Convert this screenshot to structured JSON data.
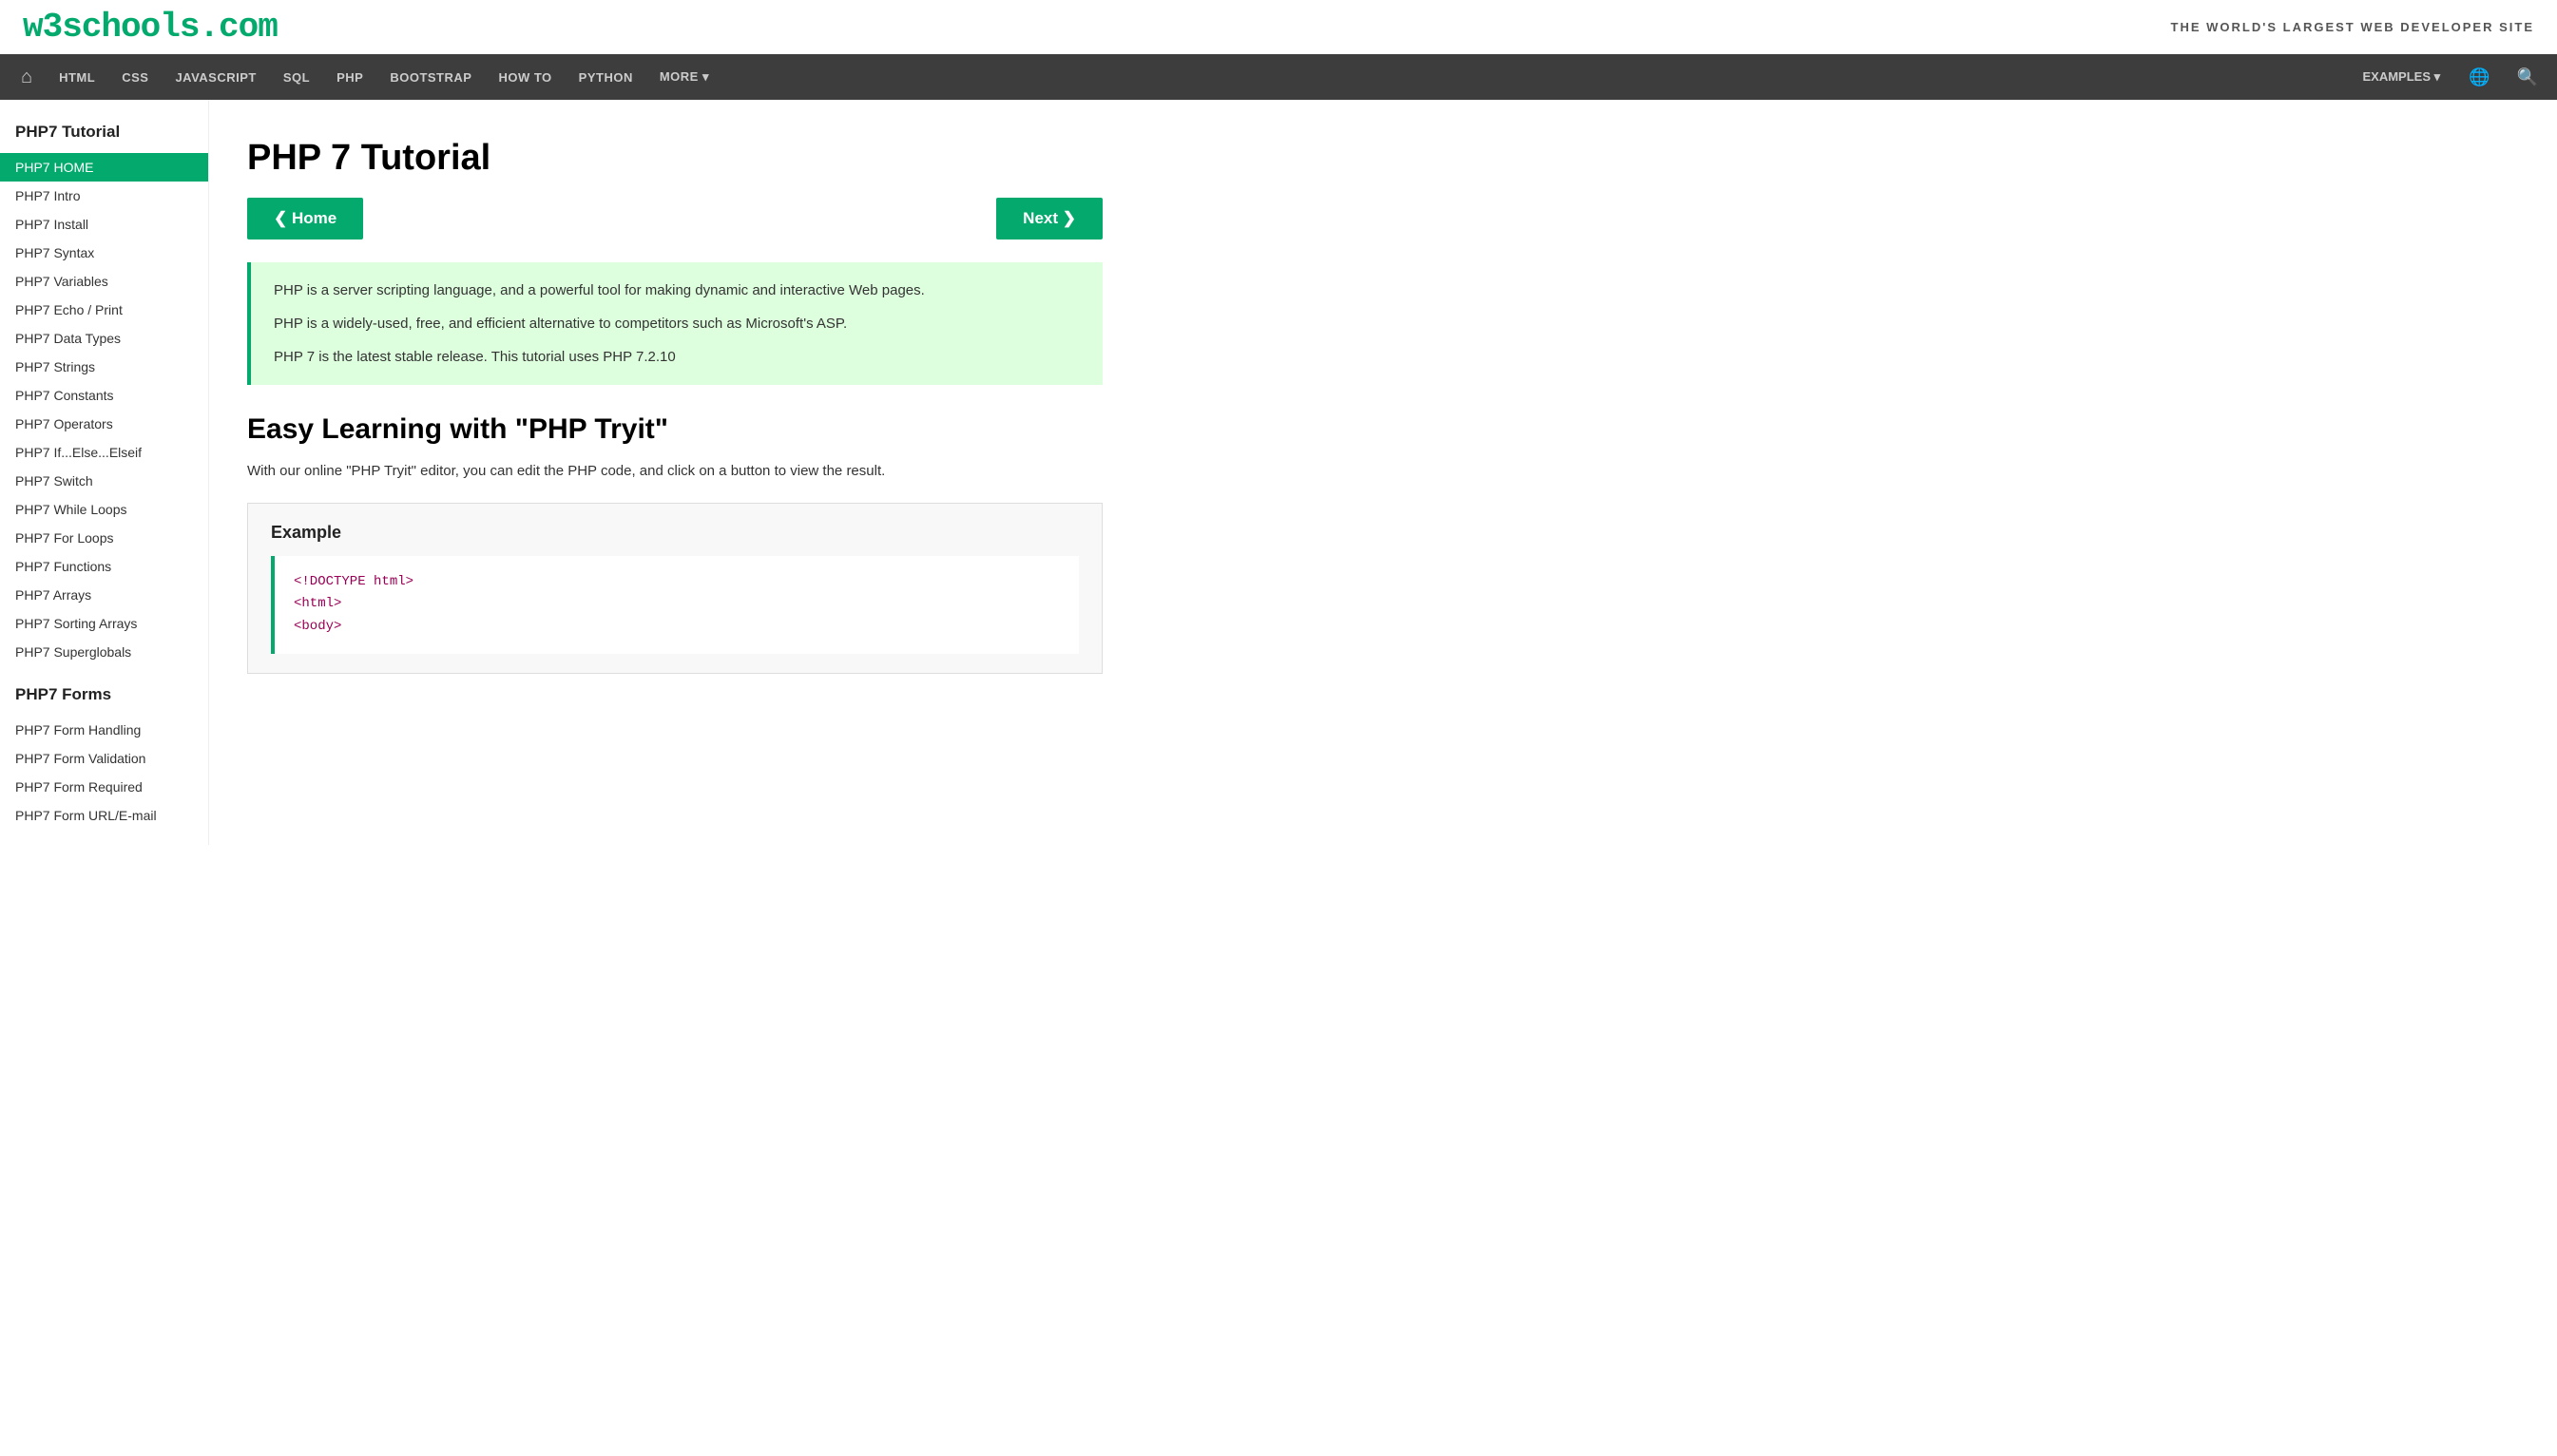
{
  "brand": {
    "logo": "w3schools.com",
    "tagline": "THE WORLD'S LARGEST WEB DEVELOPER SITE"
  },
  "nav": {
    "home_icon": "⌂",
    "items": [
      "HTML",
      "CSS",
      "JAVASCRIPT",
      "SQL",
      "PHP",
      "BOOTSTRAP",
      "HOW TO",
      "PYTHON",
      "MORE ▾"
    ],
    "right_items": [
      "EXAMPLES ▾"
    ],
    "globe_icon": "🌐",
    "search_icon": "🔍"
  },
  "sidebar": {
    "sections": [
      {
        "title": "PHP7 Tutorial",
        "items": [
          {
            "label": "PHP7 HOME",
            "active": true
          },
          {
            "label": "PHP7 Intro",
            "active": false
          },
          {
            "label": "PHP7 Install",
            "active": false
          },
          {
            "label": "PHP7 Syntax",
            "active": false
          },
          {
            "label": "PHP7 Variables",
            "active": false
          },
          {
            "label": "PHP7 Echo / Print",
            "active": false
          },
          {
            "label": "PHP7 Data Types",
            "active": false
          },
          {
            "label": "PHP7 Strings",
            "active": false
          },
          {
            "label": "PHP7 Constants",
            "active": false
          },
          {
            "label": "PHP7 Operators",
            "active": false
          },
          {
            "label": "PHP7 If...Else...Elseif",
            "active": false
          },
          {
            "label": "PHP7 Switch",
            "active": false
          },
          {
            "label": "PHP7 While Loops",
            "active": false
          },
          {
            "label": "PHP7 For Loops",
            "active": false
          },
          {
            "label": "PHP7 Functions",
            "active": false
          },
          {
            "label": "PHP7 Arrays",
            "active": false
          },
          {
            "label": "PHP7 Sorting Arrays",
            "active": false
          },
          {
            "label": "PHP7 Superglobals",
            "active": false
          }
        ]
      },
      {
        "title": "PHP7 Forms",
        "items": [
          {
            "label": "PHP7 Form Handling",
            "active": false
          },
          {
            "label": "PHP7 Form Validation",
            "active": false
          },
          {
            "label": "PHP7 Form Required",
            "active": false
          },
          {
            "label": "PHP7 Form URL/E-mail",
            "active": false
          }
        ]
      }
    ]
  },
  "main": {
    "page_title": "PHP 7 Tutorial",
    "btn_home": "❮ Home",
    "btn_next": "Next ❯",
    "info_lines": [
      "PHP is a server scripting language, and a powerful tool for making dynamic and interactive Web pages.",
      "PHP is a widely-used, free, and efficient alternative to competitors such as Microsoft's ASP.",
      "PHP 7 is the latest stable release. This tutorial uses PHP 7.2.10"
    ],
    "section_heading": "Easy Learning with \"PHP Tryit\"",
    "section_text": "With our online \"PHP Tryit\" editor, you can edit the PHP code, and click on a button to view the result.",
    "example_label": "Example",
    "code_lines": [
      "<!DOCTYPE html>",
      "<html>",
      "<body>"
    ]
  }
}
